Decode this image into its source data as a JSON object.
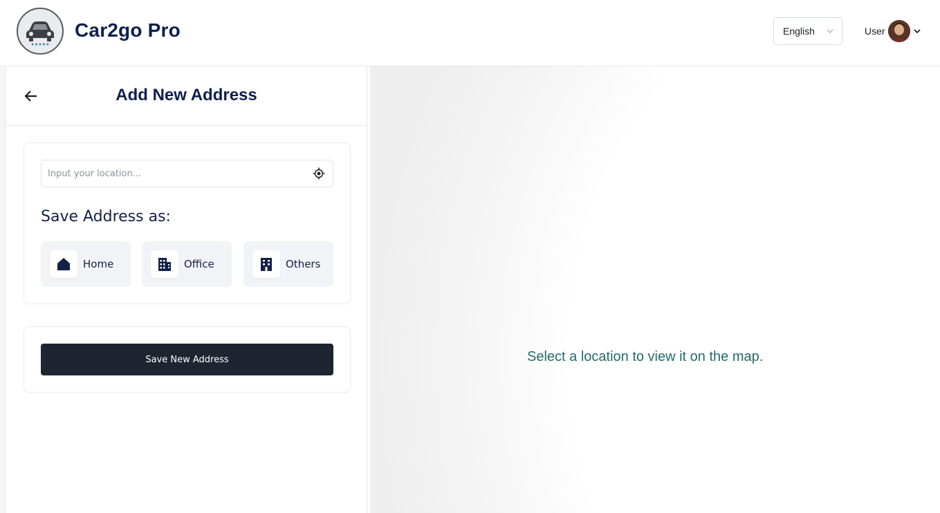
{
  "header": {
    "brand": "Car2go Pro",
    "language": "English",
    "user_label": "User",
    "icons": {
      "logo": "car-logo-icon",
      "chevron": "chevron-down-icon",
      "avatar": "user-avatar"
    }
  },
  "panel": {
    "title": "Add New Address",
    "back_icon": "arrow-left-icon",
    "location_placeholder": "Input your location...",
    "location_value": "",
    "gps_icon": "crosshair-icon",
    "save_as_heading": "Save Address as:",
    "options": [
      {
        "label": "Home",
        "icon": "home-icon"
      },
      {
        "label": "Office",
        "icon": "building-icon"
      },
      {
        "label": "Others",
        "icon": "building-icon"
      }
    ],
    "save_button": "Save New Address"
  },
  "map": {
    "message": "Select a location to view it on the map."
  },
  "colors": {
    "brand_text": "#0e1f4d",
    "button_bg": "#1e2430",
    "map_message": "#236a6b",
    "option_bg": "#f2f3f7"
  }
}
